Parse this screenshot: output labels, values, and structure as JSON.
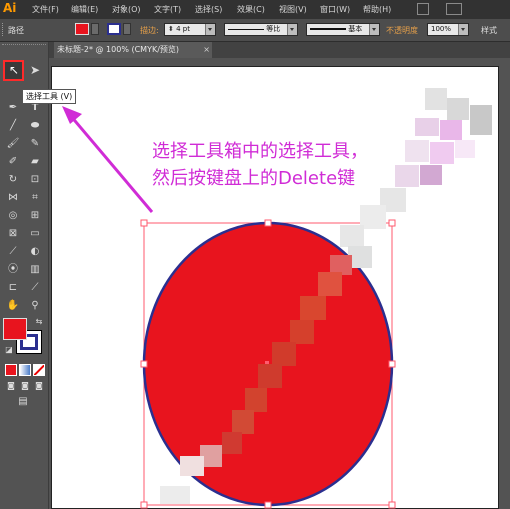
{
  "app": {
    "logo": "Ai"
  },
  "menu": [
    "文件(F)",
    "编辑(E)",
    "对象(O)",
    "文字(T)",
    "选择(S)",
    "效果(C)",
    "视图(V)",
    "窗口(W)",
    "帮助(H)"
  ],
  "control_bar": {
    "path_label": "路径",
    "stroke_label": "描边:",
    "stroke_value": "4 pt",
    "profile_label": "等比",
    "brush_label": "基本",
    "opacity_label": "不透明度",
    "opacity_value": "100%",
    "style_label": "样式"
  },
  "tab": {
    "title": "未标题-2* @ 100% (CMYK/预览)",
    "close": "×"
  },
  "tooltip": "选择工具 (V)",
  "instruction": {
    "line1": "选择工具箱中的选择工具，",
    "line2": "然后按键盘上的Delete键"
  },
  "colors": {
    "fill": "#e8141e",
    "stroke": "#2b2f8f",
    "annotation": "#d02cd6",
    "selection_box": "#ff5a6e"
  },
  "icons": {
    "selection": "selection-tool-icon",
    "direct": "direct-selection-icon"
  }
}
